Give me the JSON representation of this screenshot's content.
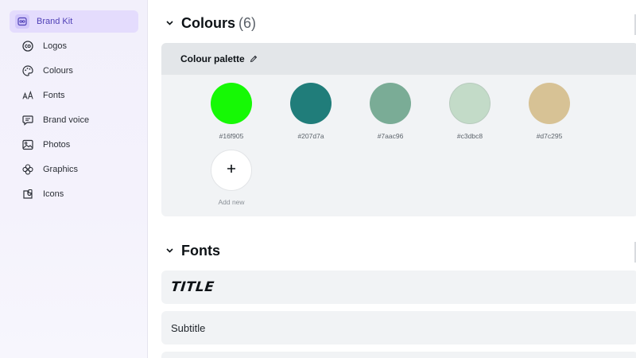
{
  "sidebar": {
    "items": [
      {
        "label": "Brand Kit",
        "icon": "brand-kit-icon",
        "active": true
      },
      {
        "label": "Logos",
        "icon": "logo-icon"
      },
      {
        "label": "Colours",
        "icon": "palette-icon"
      },
      {
        "label": "Fonts",
        "icon": "font-icon"
      },
      {
        "label": "Brand voice",
        "icon": "brand-voice-icon"
      },
      {
        "label": "Photos",
        "icon": "photo-icon"
      },
      {
        "label": "Graphics",
        "icon": "graphics-icon"
      },
      {
        "label": "Icons",
        "icon": "icons-icon"
      }
    ]
  },
  "colours_section": {
    "title": "Colours",
    "count": "(6)",
    "palette": {
      "name": "Colour palette",
      "swatches": [
        {
          "hex": "#16f905",
          "label": "#16f905"
        },
        {
          "hex": "#207d7a",
          "label": "#207d7a"
        },
        {
          "hex": "#7aac96",
          "label": "#7aac96"
        },
        {
          "hex": "#c3dbc8",
          "label": "#c3dbc8"
        },
        {
          "hex": "#d7c295",
          "label": "#d7c295"
        }
      ],
      "add_label": "Add new"
    }
  },
  "fonts_section": {
    "title": "Fonts",
    "rows": [
      {
        "label": "TITLE"
      },
      {
        "label": "Subtitle"
      }
    ]
  },
  "colors": {
    "accent": "#4e3fb6",
    "active_bg": "#e4dcfd",
    "card_bg": "#f1f3f5"
  }
}
